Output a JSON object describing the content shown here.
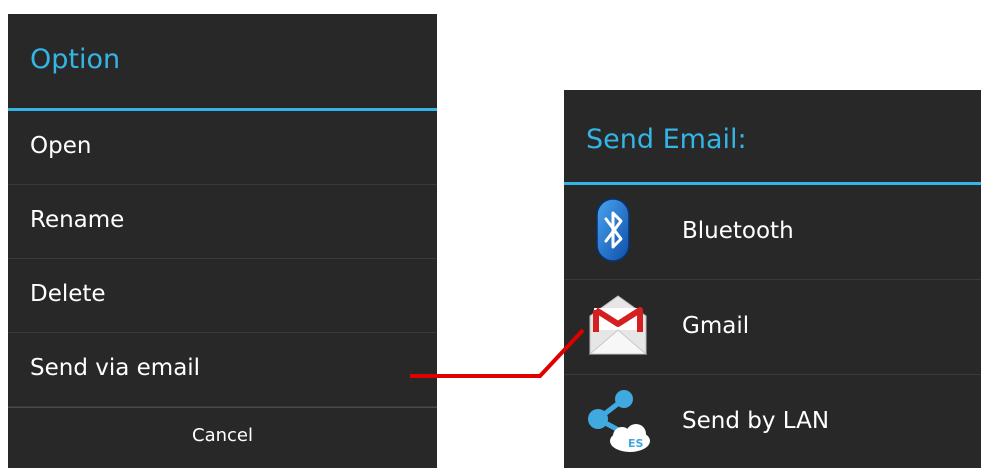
{
  "option_dialog": {
    "title": "Option",
    "items": [
      {
        "label": "Open"
      },
      {
        "label": "Rename"
      },
      {
        "label": "Delete"
      },
      {
        "label": "Send via email"
      }
    ],
    "cancel_label": "Cancel"
  },
  "send_dialog": {
    "title": "Send Email:",
    "apps": [
      {
        "label": "Bluetooth",
        "icon": "bluetooth-icon"
      },
      {
        "label": "Gmail",
        "icon": "gmail-icon"
      },
      {
        "label": "Send by LAN",
        "icon": "lan-share-icon"
      }
    ]
  },
  "colors": {
    "accent": "#33b5e5",
    "dialog_bg": "#282828",
    "connector": "#e00000"
  }
}
